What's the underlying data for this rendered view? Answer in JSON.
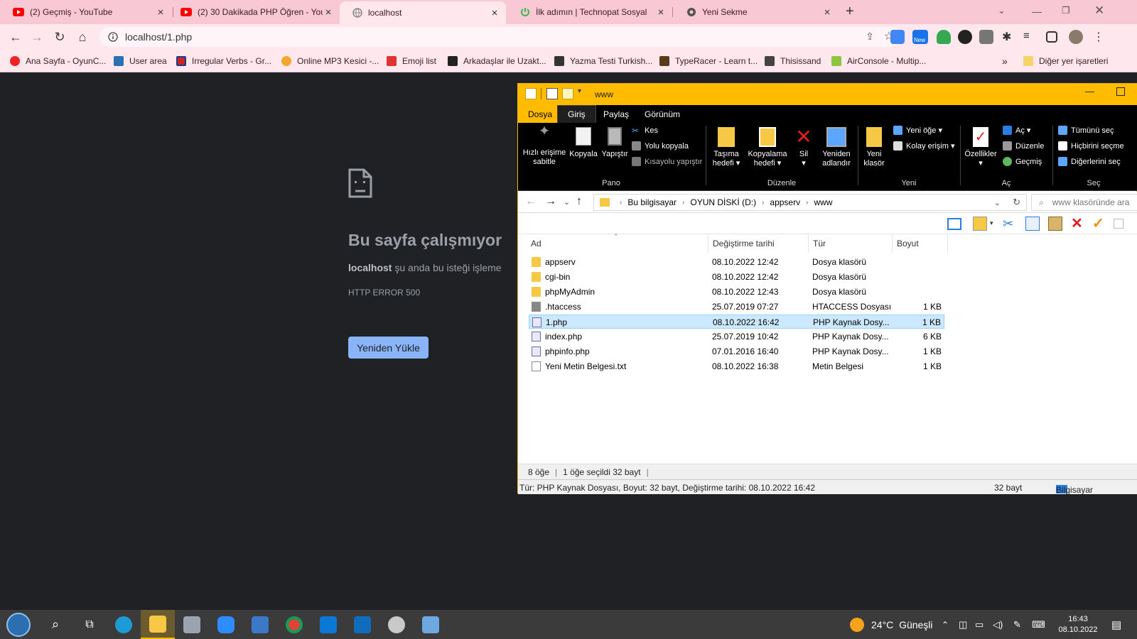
{
  "browser": {
    "tabs": [
      {
        "title": "(2) Geçmiş - YouTube",
        "icon": "youtube-icon"
      },
      {
        "title": "(2) 30 Dakikada PHP Öğren - You",
        "icon": "youtube-icon"
      },
      {
        "title": "localhost",
        "icon": "globe-icon"
      },
      {
        "title": "İlk adımın | Technopat Sosyal",
        "icon": "power-icon"
      },
      {
        "title": "Yeni Sekme",
        "icon": "chrome-icon"
      }
    ],
    "url": "localhost/1.php",
    "ext_new_badge": "New",
    "bookmarks": [
      "Ana Sayfa - OyunC...",
      "User area",
      "Irregular Verbs - Gr...",
      "Online MP3 Kesici -...",
      "Emoji list",
      "Arkadaşlar ile Uzakt...",
      "Yazma Testi Turkish...",
      "TypeRacer - Learn t...",
      "Thisissand",
      "AirConsole - Multip..."
    ],
    "bookmarks_overflow": "»",
    "other_bookmarks": "Diğer yer işaretleri"
  },
  "error_page": {
    "title": "Bu sayfa çalışmıyor",
    "host": "localhost",
    "message": " şu anda bu isteği işleme",
    "code": "HTTP ERROR 500",
    "reload_label": "Yeniden Yükle"
  },
  "explorer": {
    "window_title": "www",
    "ribbon_tabs": {
      "file": "Dosya",
      "home": "Giriş",
      "share": "Paylaş",
      "view": "Görünüm"
    },
    "ribbon": {
      "pin": "Hızlı erişime sabitle",
      "copy": "Kopyala",
      "paste": "Yapıştır",
      "cut": "Kes",
      "copy_path": "Yolu kopyala",
      "paste_shortcut": "Kısayolu yapıştır",
      "move_to": "Taşıma hedefi",
      "copy_to": "Kopyalama hedefi",
      "delete": "Sil",
      "rename": "Yeniden adlandır",
      "new_folder": "Yeni klasör",
      "new_item": "Yeni öğe",
      "easy_access": "Kolay erişim",
      "properties": "Özellikler",
      "open": "Aç",
      "edit": "Düzenle",
      "history": "Geçmiş",
      "select_all": "Tümünü seç",
      "select_none": "Hiçbirini seçme",
      "invert": "Diğerlerini seç",
      "groups": {
        "clipboard": "Pano",
        "organize": "Düzenle",
        "new": "Yeni",
        "open": "Aç",
        "select": "Seç"
      }
    },
    "breadcrumb": [
      "Bu bilgisayar",
      "OYUN DİSKİ (D:)",
      "appserv",
      "www"
    ],
    "search_placeholder": "www klasöründe ara",
    "columns": {
      "name": "Ad",
      "date": "Değiştirme tarihi",
      "type": "Tür",
      "size": "Boyut"
    },
    "files": [
      {
        "name": "appserv",
        "date": "08.10.2022 12:42",
        "type": "Dosya klasörü",
        "size": "",
        "kind": "folder"
      },
      {
        "name": "cgi-bin",
        "date": "08.10.2022 12:42",
        "type": "Dosya klasörü",
        "size": "",
        "kind": "folder"
      },
      {
        "name": "phpMyAdmin",
        "date": "08.10.2022 12:43",
        "type": "Dosya klasörü",
        "size": "",
        "kind": "folder"
      },
      {
        "name": ".htaccess",
        "date": "25.07.2019 07:27",
        "type": "HTACCESS Dosyası",
        "size": "1 KB",
        "kind": "generic"
      },
      {
        "name": "1.php",
        "date": "08.10.2022 16:42",
        "type": "PHP Kaynak Dosy...",
        "size": "1 KB",
        "kind": "php",
        "selected": true
      },
      {
        "name": "index.php",
        "date": "25.07.2019 10:42",
        "type": "PHP Kaynak Dosy...",
        "size": "6 KB",
        "kind": "php"
      },
      {
        "name": "phpinfo.php",
        "date": "07.01.2016 16:40",
        "type": "PHP Kaynak Dosy...",
        "size": "1 KB",
        "kind": "php"
      },
      {
        "name": "Yeni Metin Belgesi.txt",
        "date": "08.10.2022 16:38",
        "type": "Metin Belgesi",
        "size": "1 KB",
        "kind": "text"
      }
    ],
    "status": {
      "count": "8 öğe",
      "selected": "1 öğe seçildi  32 bayt"
    },
    "details": {
      "info": "Tür: PHP Kaynak Dosyası, Boyut: 32 bayt, Değiştirme tarihi: 08.10.2022 16:42",
      "size": "32 bayt",
      "location": "Bilgisayar"
    }
  },
  "taskbar": {
    "weather_temp": "24°C",
    "weather_text": "Güneşli",
    "time": "16:43",
    "date": "08.10.2022"
  }
}
